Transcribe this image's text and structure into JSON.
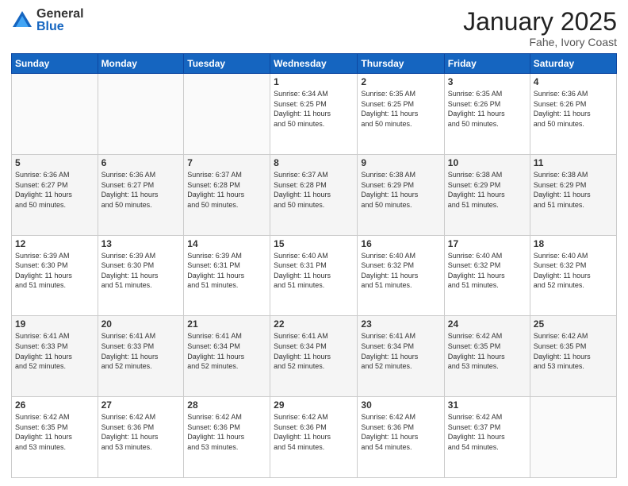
{
  "logo": {
    "general": "General",
    "blue": "Blue"
  },
  "header": {
    "month": "January 2025",
    "location": "Fahe, Ivory Coast"
  },
  "weekdays": [
    "Sunday",
    "Monday",
    "Tuesday",
    "Wednesday",
    "Thursday",
    "Friday",
    "Saturday"
  ],
  "weeks": [
    [
      {
        "day": "",
        "info": ""
      },
      {
        "day": "",
        "info": ""
      },
      {
        "day": "",
        "info": ""
      },
      {
        "day": "1",
        "info": "Sunrise: 6:34 AM\nSunset: 6:25 PM\nDaylight: 11 hours\nand 50 minutes."
      },
      {
        "day": "2",
        "info": "Sunrise: 6:35 AM\nSunset: 6:25 PM\nDaylight: 11 hours\nand 50 minutes."
      },
      {
        "day": "3",
        "info": "Sunrise: 6:35 AM\nSunset: 6:26 PM\nDaylight: 11 hours\nand 50 minutes."
      },
      {
        "day": "4",
        "info": "Sunrise: 6:36 AM\nSunset: 6:26 PM\nDaylight: 11 hours\nand 50 minutes."
      }
    ],
    [
      {
        "day": "5",
        "info": "Sunrise: 6:36 AM\nSunset: 6:27 PM\nDaylight: 11 hours\nand 50 minutes."
      },
      {
        "day": "6",
        "info": "Sunrise: 6:36 AM\nSunset: 6:27 PM\nDaylight: 11 hours\nand 50 minutes."
      },
      {
        "day": "7",
        "info": "Sunrise: 6:37 AM\nSunset: 6:28 PM\nDaylight: 11 hours\nand 50 minutes."
      },
      {
        "day": "8",
        "info": "Sunrise: 6:37 AM\nSunset: 6:28 PM\nDaylight: 11 hours\nand 50 minutes."
      },
      {
        "day": "9",
        "info": "Sunrise: 6:38 AM\nSunset: 6:29 PM\nDaylight: 11 hours\nand 50 minutes."
      },
      {
        "day": "10",
        "info": "Sunrise: 6:38 AM\nSunset: 6:29 PM\nDaylight: 11 hours\nand 51 minutes."
      },
      {
        "day": "11",
        "info": "Sunrise: 6:38 AM\nSunset: 6:29 PM\nDaylight: 11 hours\nand 51 minutes."
      }
    ],
    [
      {
        "day": "12",
        "info": "Sunrise: 6:39 AM\nSunset: 6:30 PM\nDaylight: 11 hours\nand 51 minutes."
      },
      {
        "day": "13",
        "info": "Sunrise: 6:39 AM\nSunset: 6:30 PM\nDaylight: 11 hours\nand 51 minutes."
      },
      {
        "day": "14",
        "info": "Sunrise: 6:39 AM\nSunset: 6:31 PM\nDaylight: 11 hours\nand 51 minutes."
      },
      {
        "day": "15",
        "info": "Sunrise: 6:40 AM\nSunset: 6:31 PM\nDaylight: 11 hours\nand 51 minutes."
      },
      {
        "day": "16",
        "info": "Sunrise: 6:40 AM\nSunset: 6:32 PM\nDaylight: 11 hours\nand 51 minutes."
      },
      {
        "day": "17",
        "info": "Sunrise: 6:40 AM\nSunset: 6:32 PM\nDaylight: 11 hours\nand 51 minutes."
      },
      {
        "day": "18",
        "info": "Sunrise: 6:40 AM\nSunset: 6:32 PM\nDaylight: 11 hours\nand 52 minutes."
      }
    ],
    [
      {
        "day": "19",
        "info": "Sunrise: 6:41 AM\nSunset: 6:33 PM\nDaylight: 11 hours\nand 52 minutes."
      },
      {
        "day": "20",
        "info": "Sunrise: 6:41 AM\nSunset: 6:33 PM\nDaylight: 11 hours\nand 52 minutes."
      },
      {
        "day": "21",
        "info": "Sunrise: 6:41 AM\nSunset: 6:34 PM\nDaylight: 11 hours\nand 52 minutes."
      },
      {
        "day": "22",
        "info": "Sunrise: 6:41 AM\nSunset: 6:34 PM\nDaylight: 11 hours\nand 52 minutes."
      },
      {
        "day": "23",
        "info": "Sunrise: 6:41 AM\nSunset: 6:34 PM\nDaylight: 11 hours\nand 52 minutes."
      },
      {
        "day": "24",
        "info": "Sunrise: 6:42 AM\nSunset: 6:35 PM\nDaylight: 11 hours\nand 53 minutes."
      },
      {
        "day": "25",
        "info": "Sunrise: 6:42 AM\nSunset: 6:35 PM\nDaylight: 11 hours\nand 53 minutes."
      }
    ],
    [
      {
        "day": "26",
        "info": "Sunrise: 6:42 AM\nSunset: 6:35 PM\nDaylight: 11 hours\nand 53 minutes."
      },
      {
        "day": "27",
        "info": "Sunrise: 6:42 AM\nSunset: 6:36 PM\nDaylight: 11 hours\nand 53 minutes."
      },
      {
        "day": "28",
        "info": "Sunrise: 6:42 AM\nSunset: 6:36 PM\nDaylight: 11 hours\nand 53 minutes."
      },
      {
        "day": "29",
        "info": "Sunrise: 6:42 AM\nSunset: 6:36 PM\nDaylight: 11 hours\nand 54 minutes."
      },
      {
        "day": "30",
        "info": "Sunrise: 6:42 AM\nSunset: 6:36 PM\nDaylight: 11 hours\nand 54 minutes."
      },
      {
        "day": "31",
        "info": "Sunrise: 6:42 AM\nSunset: 6:37 PM\nDaylight: 11 hours\nand 54 minutes."
      },
      {
        "day": "",
        "info": ""
      }
    ]
  ]
}
